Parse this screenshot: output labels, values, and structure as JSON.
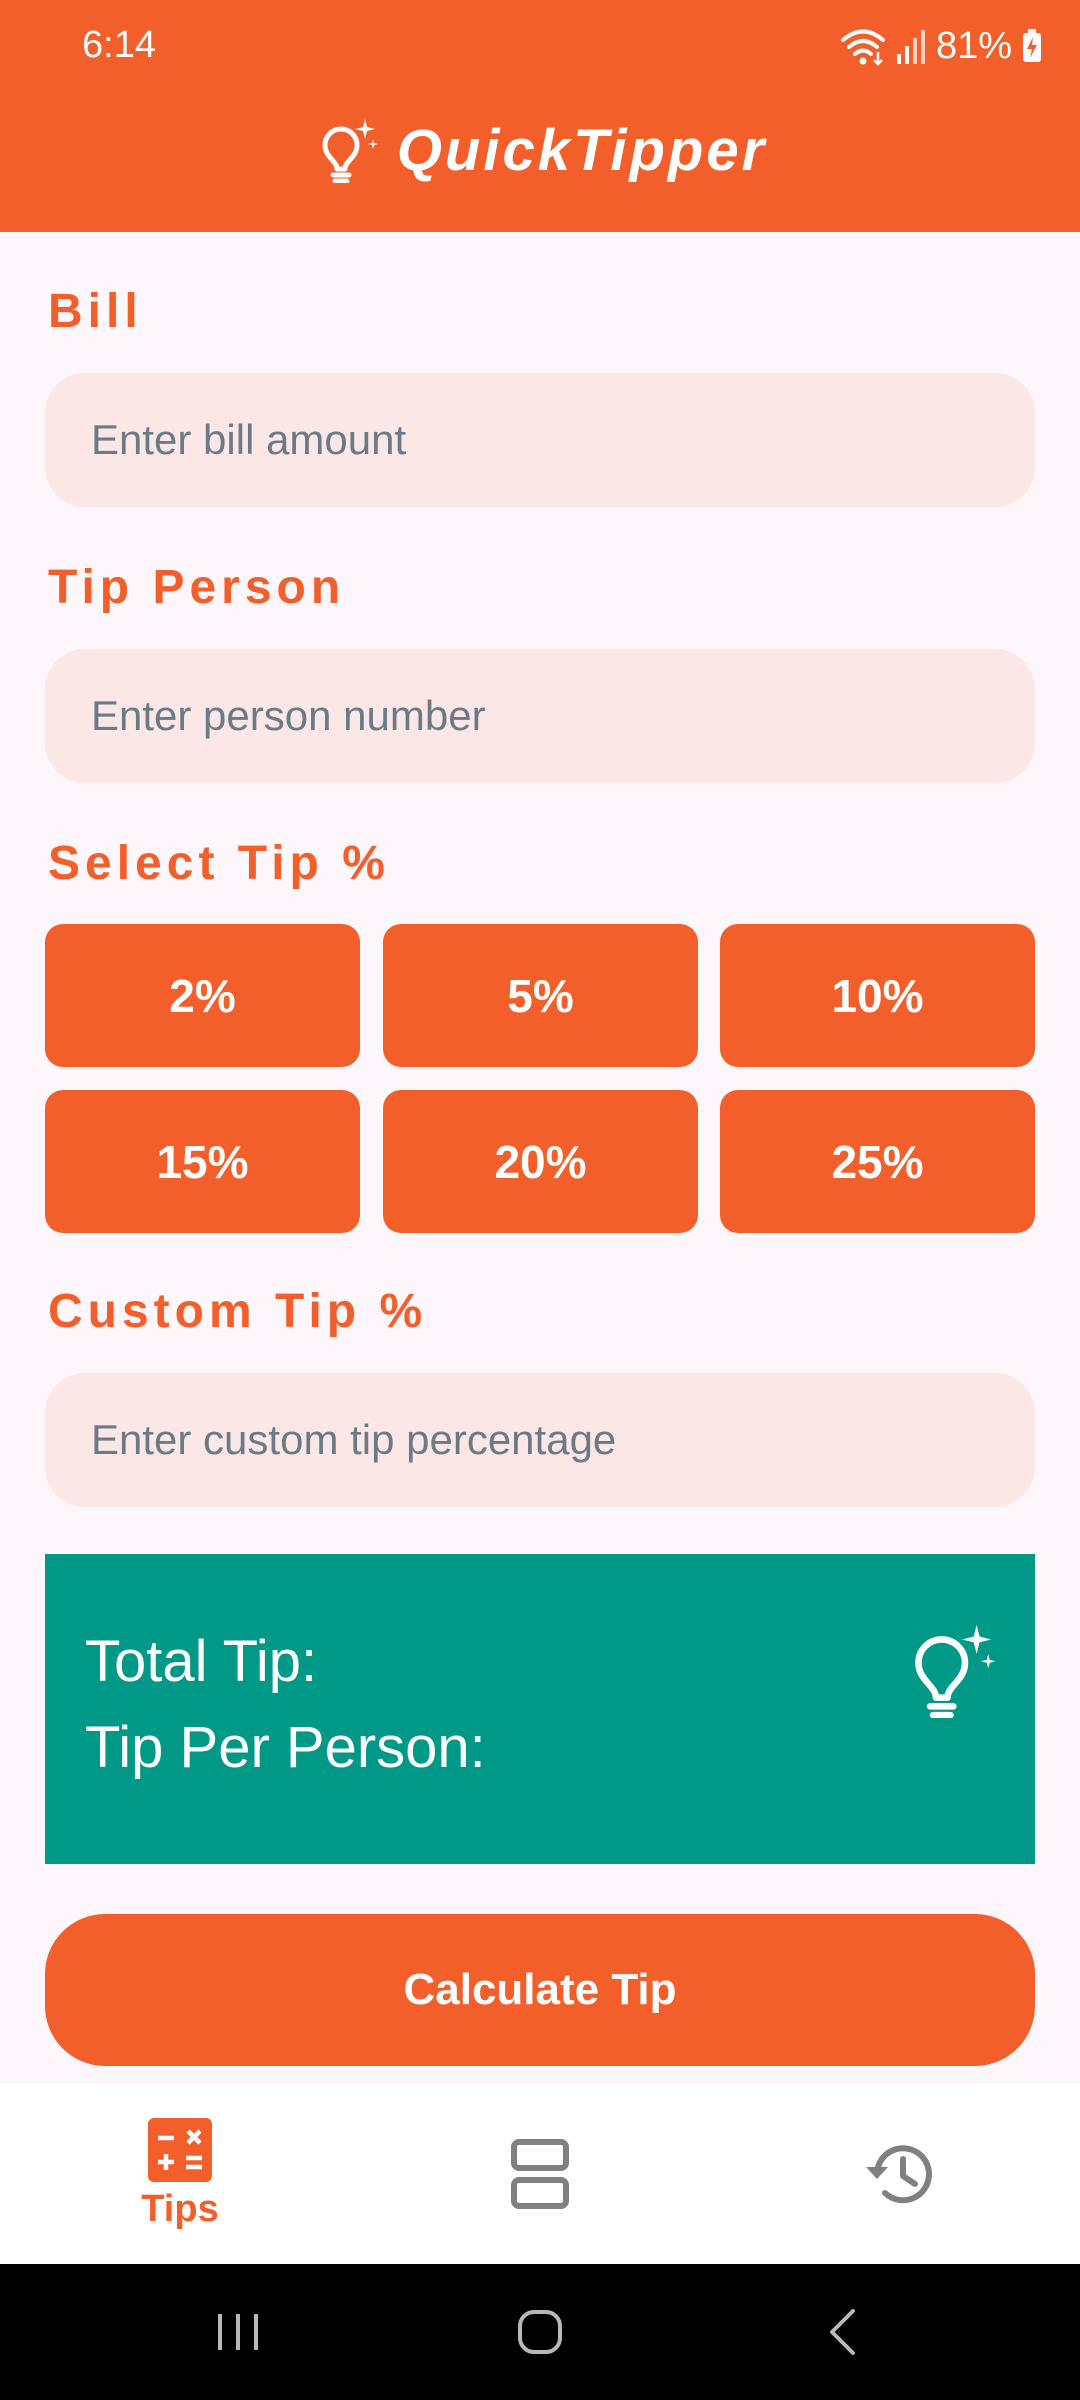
{
  "status_bar": {
    "time": "6:14",
    "battery": "81%"
  },
  "header": {
    "app_title": "QuickTipper"
  },
  "form": {
    "bill_label": "Bill",
    "bill_placeholder": "Enter bill amount",
    "person_label": "Tip Person",
    "person_placeholder": "Enter person number",
    "select_tip_label": "Select Tip %",
    "tip_options": [
      "2%",
      "5%",
      "10%",
      "15%",
      "20%",
      "25%"
    ],
    "custom_tip_label": "Custom Tip %",
    "custom_tip_placeholder": "Enter custom tip percentage"
  },
  "result": {
    "total_tip_label": "Total Tip:",
    "tip_per_person_label": "Tip Per Person:"
  },
  "actions": {
    "calculate_label": "Calculate Tip"
  },
  "bottom_nav": {
    "tips_label": "Tips"
  },
  "colors": {
    "accent": "#f25f2a",
    "teal": "#009887",
    "input_bg": "#fce7e7",
    "page_bg": "#fdf6fb"
  },
  "icons": [
    "lightbulb-sparkle-icon",
    "calculator-icon",
    "layout-icon",
    "history-icon",
    "wifi-icon",
    "signal-icon",
    "battery-icon"
  ]
}
